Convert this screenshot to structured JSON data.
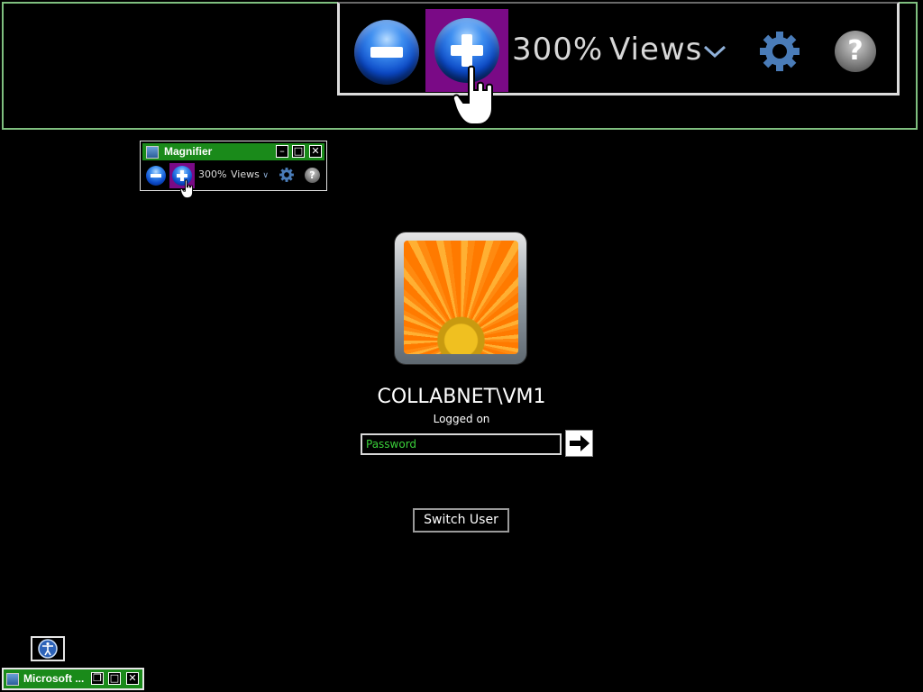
{
  "lens": {
    "zoom_level": "300%",
    "views_label": "Views",
    "zoom_out_icon": "zoom-out-icon",
    "zoom_in_icon": "zoom-in-icon",
    "settings_icon": "gear-icon",
    "help_icon": "help-icon",
    "help_glyph": "?",
    "highlight_color": "#7a0a86",
    "frame_color": "#7fbf7f"
  },
  "magnifier_window": {
    "title": "Magnifier",
    "zoom_level": "300%",
    "views_label": "Views",
    "minimize_glyph": "–",
    "maximize_glyph": "□",
    "close_glyph": "✕",
    "help_glyph": "?",
    "title_bar_color": "#1a8a1a"
  },
  "logon": {
    "user_name": "COLLABNET\\VM1",
    "status": "Logged on",
    "password_placeholder": "Password",
    "submit_icon": "arrow-right-icon",
    "switch_user_label": "Switch User",
    "placeholder_color": "#3ad03a"
  },
  "taskbar_window": {
    "title": "Microsoft ...",
    "restore_glyph": "❐",
    "maximize_glyph": "□",
    "close_glyph": "✕"
  },
  "ease_of_access": {
    "icon": "ease-of-access-icon"
  }
}
